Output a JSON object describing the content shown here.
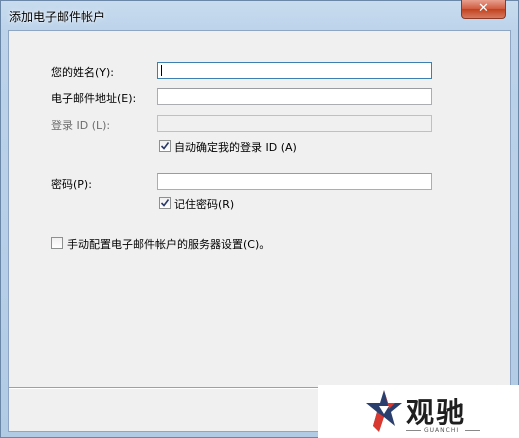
{
  "window": {
    "title": "添加电子邮件帐户"
  },
  "form": {
    "name_label": "您的姓名(Y):",
    "name_value": "",
    "email_label": "电子邮件地址(E):",
    "email_value": "",
    "login_label": "登录 ID (L):",
    "login_value": "",
    "auto_login_label": "自动确定我的登录 ID (A)",
    "auto_login_checked": true,
    "password_label": "密码(P):",
    "password_value": "",
    "remember_label": "记住密码(R)",
    "remember_checked": true,
    "manual_config_label": "手动配置电子邮件帐户的服务器设置(C)。",
    "manual_config_checked": false
  },
  "watermark": {
    "brand": "观驰",
    "sub": "GUANCHI",
    "icon": "star-logo-icon"
  }
}
